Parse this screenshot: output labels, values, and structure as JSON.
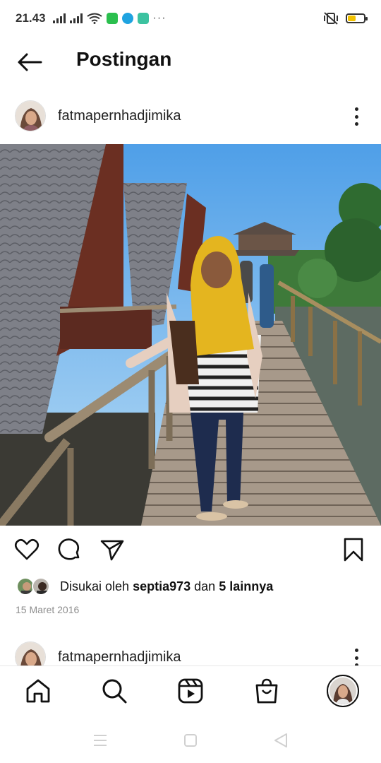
{
  "status_bar": {
    "time": "21.43",
    "overflow_dots": "···",
    "icons": [
      "signal-icon",
      "signal-icon",
      "wifi-icon",
      "line-app-icon",
      "app-icon",
      "app-icon",
      "mute-vibrate-icon",
      "battery-icon"
    ],
    "battery_level": 0.5,
    "battery_color": "#f2c200"
  },
  "header": {
    "back_icon": "arrow-left-icon",
    "title": "Postingan"
  },
  "post": {
    "username": "fatmapernhadjimika",
    "more_icon": "three-dots-vertical-icon",
    "photo_icon": "photo",
    "actions": {
      "like_icon": "heart-icon",
      "comment_icon": "comment-icon",
      "share_icon": "send-icon",
      "save_icon": "bookmark-icon"
    },
    "likes_prefix": "Disukai oleh",
    "liked_by_user": "septia973",
    "likes_connector": "dan",
    "others_count_text": "5 lainnya",
    "date": "15 Maret 2016"
  },
  "next_post": {
    "username": "fatmapernhadjimika"
  },
  "bottom_nav": {
    "items": [
      "home-icon",
      "search-icon",
      "reels-icon",
      "shop-icon",
      "profile-avatar"
    ]
  },
  "system_nav": {
    "items": [
      "menu-icon",
      "home-square-icon",
      "back-triangle-icon"
    ]
  },
  "colors": {
    "text": "#111111",
    "secondary": "#8e8e8e",
    "divider": "#e6e6e6",
    "hijab_yellow": "#e4b51f"
  }
}
